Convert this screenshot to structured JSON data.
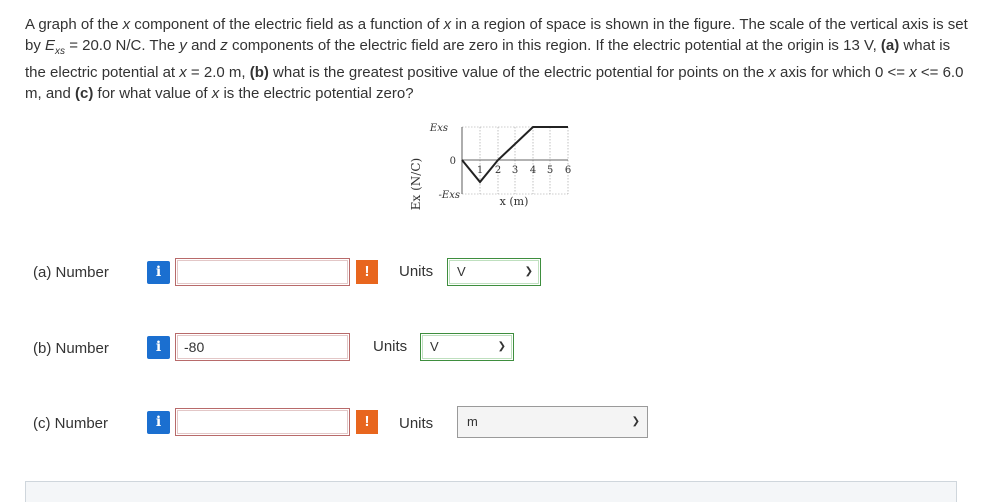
{
  "question": {
    "s1": "A graph of the ",
    "s2": "x",
    "s3": " component of the electric field as a function of ",
    "s4": "x",
    "s5": " in a region of space is shown in the figure. The scale of the vertical axis is set by ",
    "s6": "E",
    "s7": "xs",
    "s8": " = 20.0 N/C. The ",
    "s9": "y",
    "s10": " and ",
    "s11": "z",
    "s12": " components of the electric field are zero in this region. If the electric potential at the origin is 13 V, ",
    "s13": "(a)",
    "s14": " what is the electric potential at ",
    "s15": "x",
    "s16": " = 2.0 m, ",
    "s17": "(b)",
    "s18": " what is the greatest positive value of the electric potential for points on the ",
    "s19": "x",
    "s20": " axis for which 0 <= ",
    "s21": "x",
    "s22": " <= 6.0 m, and ",
    "s23": "(c)",
    "s24": " for what value of ",
    "s25": "x",
    "s26": " is the electric potential zero?"
  },
  "figure": {
    "ylabel": "Ex (N/C)",
    "ytick_top": "Exs",
    "ytick_zero": "0",
    "ytick_bottom": "-Exs",
    "xticks": [
      "1",
      "2",
      "3",
      "4",
      "5",
      "6"
    ],
    "xlabel": "x (m)"
  },
  "parts": [
    {
      "label": "(a)   Number",
      "value": "",
      "units_label": "Units",
      "unit": "V"
    },
    {
      "label": "(b)   Number",
      "value": "-80",
      "units_label": "Units",
      "unit": "V"
    },
    {
      "label": "(c)   Number",
      "value": "",
      "units_label": "Units",
      "unit": "m"
    }
  ],
  "info_icon_text": "i",
  "warn_icon_text": "!"
}
